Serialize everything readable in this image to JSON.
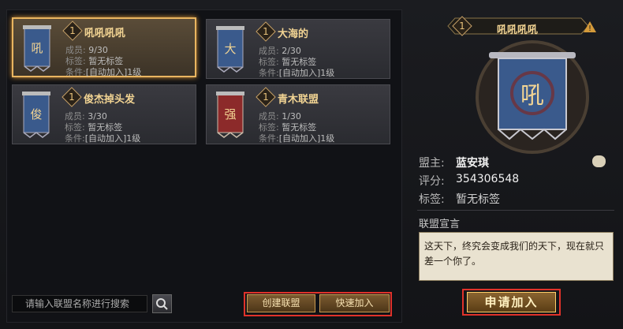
{
  "clans": [
    {
      "level": "1",
      "name": "吼吼吼吼",
      "emblem_char": "吼",
      "members_label": "成员:",
      "members": "9/30",
      "tag_label": "标签:",
      "tag": "暂无标签",
      "cond_label": "条件:",
      "cond": "[自动加入]1级",
      "banner_color": "#3a5a8c",
      "selected": true
    },
    {
      "level": "1",
      "name": "大海的",
      "emblem_char": "大",
      "members_label": "成员:",
      "members": "2/30",
      "tag_label": "标签:",
      "tag": "暂无标签",
      "cond_label": "条件:",
      "cond": "[自动加入]1级",
      "banner_color": "#3a5a8c",
      "selected": false
    },
    {
      "level": "1",
      "name": "俊杰掉头发",
      "emblem_char": "俊",
      "members_label": "成员:",
      "members": "3/30",
      "tag_label": "标签:",
      "tag": "暂无标签",
      "cond_label": "条件:",
      "cond": "[自动加入]1级",
      "banner_color": "#3a5a8c",
      "selected": false
    },
    {
      "level": "1",
      "name": "青木联盟",
      "emblem_char": "强",
      "members_label": "成员:",
      "members": "1/30",
      "tag_label": "标签:",
      "tag": "暂无标签",
      "cond_label": "条件:",
      "cond": "[自动加入]1级",
      "banner_color": "#8c2a2a",
      "selected": false
    }
  ],
  "search": {
    "placeholder": "请输入联盟名称进行搜索"
  },
  "buttons": {
    "create": "创建联盟",
    "quick_join": "快速加入",
    "apply": "申请加入"
  },
  "detail": {
    "level": "1",
    "name": "吼吼吼吼",
    "emblem_char": "吼",
    "leader_label": "盟主:",
    "leader": "蓝安琪",
    "score_label": "评分:",
    "score": "354306548",
    "tag_label": "标签:",
    "tag": "暂无标签",
    "declaration_title": "联盟宣言",
    "declaration": "这天下，终究会变成我们的天下，现在就只差一个你了。"
  },
  "colors": {
    "accent": "#e9b560",
    "highlight": "#e0322a",
    "gold_text": "#f2d493"
  }
}
